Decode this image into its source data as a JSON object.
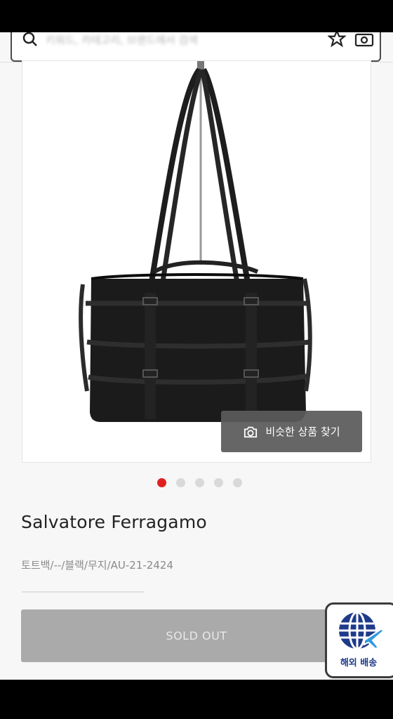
{
  "search": {
    "placeholder": "키워드, 카테고리, 브랜드에서 검색"
  },
  "product": {
    "image_button_label": "비슷한 상품 찾기",
    "carousel": {
      "total": 5,
      "active_index": 1
    },
    "brand": "Salvatore Ferragamo",
    "meta": "토트백/--/블랙/무지/AU-21-2424",
    "soldout_label": "SOLD OUT"
  },
  "overseas_badge": {
    "label": "해외 배송"
  },
  "colors": {
    "active_dot": "#e02020",
    "soldout_bg": "#aaaaaa",
    "badge_blue": "#1e3a8a"
  }
}
